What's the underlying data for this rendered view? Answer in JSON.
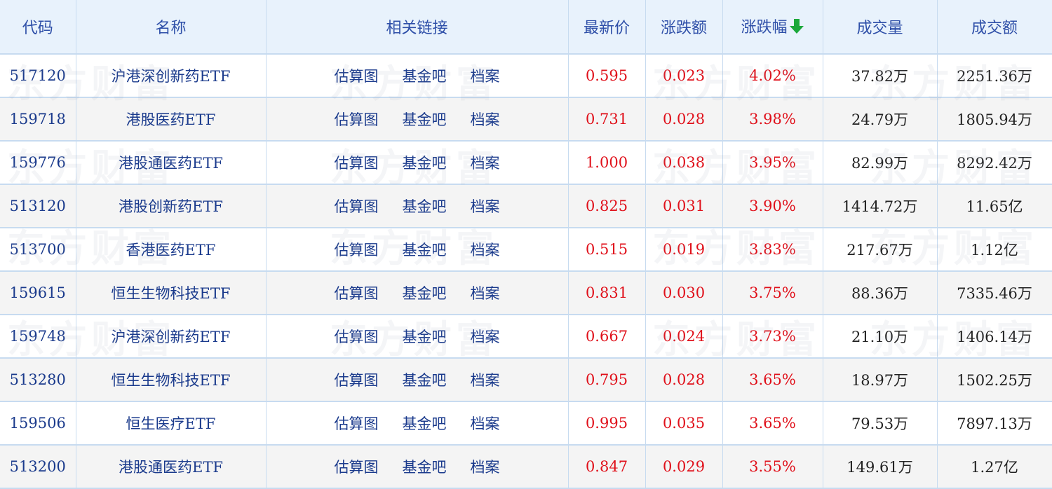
{
  "headers": {
    "code": "代码",
    "name": "名称",
    "links": "相关链接",
    "price": "最新价",
    "change": "涨跌额",
    "change_pct": "涨跌幅",
    "volume": "成交量",
    "amount": "成交额"
  },
  "watermark": "东方财富",
  "link_labels": [
    "估算图",
    "基金吧",
    "档案"
  ],
  "colors": {
    "up": "#e0101a",
    "link": "#1a3a8c",
    "sort_arrow": "#1aa83a",
    "header_bg": "#e8f2fc"
  },
  "rows": [
    {
      "code": "517120",
      "name": "沪港深创新药ETF",
      "price": "0.595",
      "change": "0.023",
      "change_pct": "4.02%",
      "volume": "37.82万",
      "amount": "2251.36万"
    },
    {
      "code": "159718",
      "name": "港股医药ETF",
      "price": "0.731",
      "change": "0.028",
      "change_pct": "3.98%",
      "volume": "24.79万",
      "amount": "1805.94万"
    },
    {
      "code": "159776",
      "name": "港股通医药ETF",
      "price": "1.000",
      "change": "0.038",
      "change_pct": "3.95%",
      "volume": "82.99万",
      "amount": "8292.42万"
    },
    {
      "code": "513120",
      "name": "港股创新药ETF",
      "price": "0.825",
      "change": "0.031",
      "change_pct": "3.90%",
      "volume": "1414.72万",
      "amount": "11.65亿"
    },
    {
      "code": "513700",
      "name": "香港医药ETF",
      "price": "0.515",
      "change": "0.019",
      "change_pct": "3.83%",
      "volume": "217.67万",
      "amount": "1.12亿"
    },
    {
      "code": "159615",
      "name": "恒生生物科技ETF",
      "price": "0.831",
      "change": "0.030",
      "change_pct": "3.75%",
      "volume": "88.36万",
      "amount": "7335.46万"
    },
    {
      "code": "159748",
      "name": "沪港深创新药ETF",
      "price": "0.667",
      "change": "0.024",
      "change_pct": "3.73%",
      "volume": "21.10万",
      "amount": "1406.14万"
    },
    {
      "code": "513280",
      "name": "恒生生物科技ETF",
      "price": "0.795",
      "change": "0.028",
      "change_pct": "3.65%",
      "volume": "18.97万",
      "amount": "1502.25万"
    },
    {
      "code": "159506",
      "name": "恒生医疗ETF",
      "price": "0.995",
      "change": "0.035",
      "change_pct": "3.65%",
      "volume": "79.53万",
      "amount": "7897.13万"
    },
    {
      "code": "513200",
      "name": "港股通医药ETF",
      "price": "0.847",
      "change": "0.029",
      "change_pct": "3.55%",
      "volume": "149.61万",
      "amount": "1.27亿"
    }
  ]
}
